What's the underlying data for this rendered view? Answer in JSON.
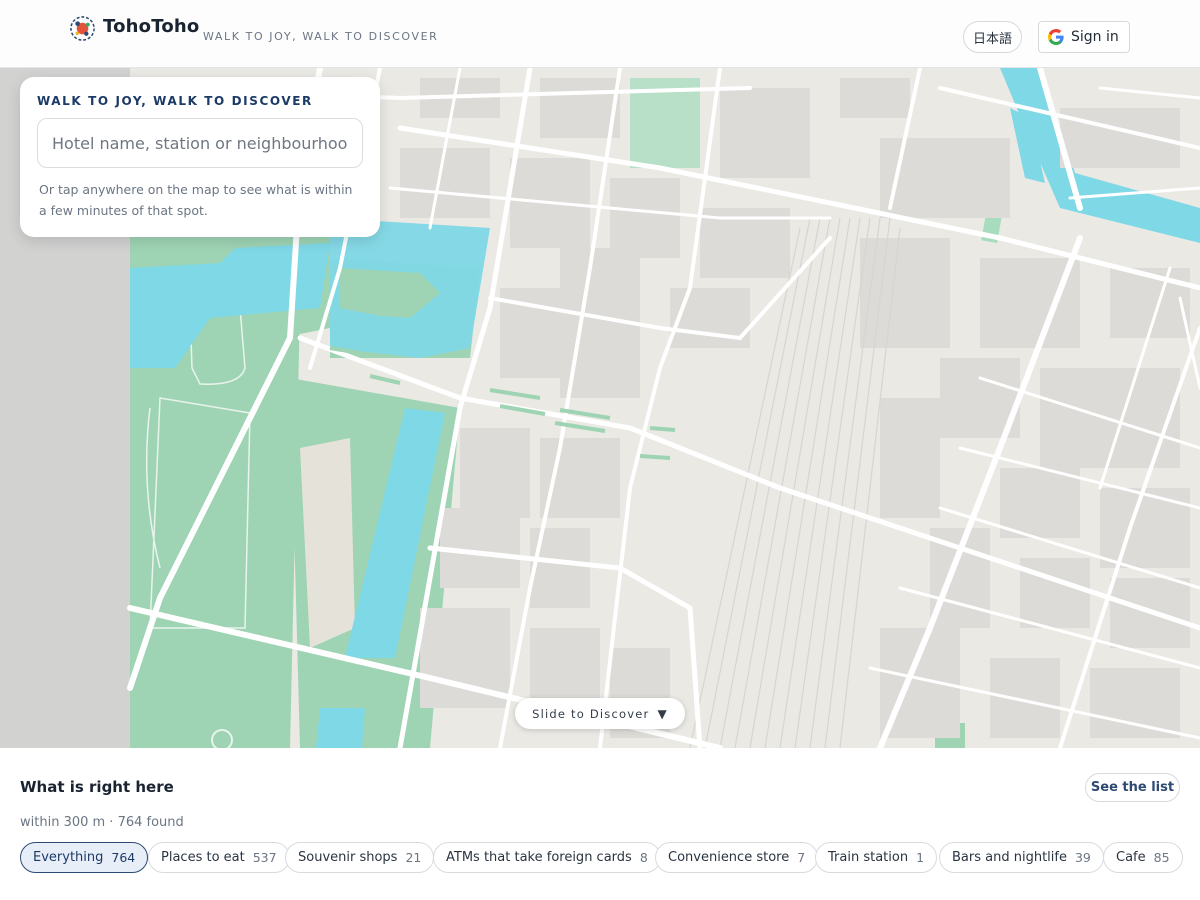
{
  "header": {
    "brand": "TohoToho",
    "tagline": "WALK TO JOY, WALK TO DISCOVER",
    "language_button": "日本語",
    "signin_label": "Sign in",
    "logo_icon": "tohotoho-logo-icon",
    "google_icon": "google-g-icon"
  },
  "search_card": {
    "heading": "WALK TO JOY, WALK TO DISCOVER",
    "placeholder": "Hotel name, station or neighbourhood",
    "value": "",
    "hint": "Or tap anywhere on the map to see what is within a few minutes of that spot."
  },
  "map": {
    "slide_label": "Slide to Discover",
    "slide_arrow": "▼",
    "colors": {
      "land": "#ebe9e4",
      "park": "#9ed4b4",
      "water": "#7fd8e6",
      "road": "#ffffff",
      "building": "#dcdbd7"
    }
  },
  "panel": {
    "title": "What is right here",
    "subtitle": "within 300 m · 764 found",
    "see_list_label": "See the list",
    "chips": [
      {
        "label": "Everything",
        "count": "764",
        "active": true
      },
      {
        "label": "Places to eat",
        "count": "537",
        "active": false
      },
      {
        "label": "Souvenir shops",
        "count": "21",
        "active": false
      },
      {
        "label": "ATMs that take foreign cards",
        "count": "8",
        "active": false
      },
      {
        "label": "Convenience store",
        "count": "7",
        "active": false
      },
      {
        "label": "Train station",
        "count": "1",
        "active": false
      },
      {
        "label": "Bars and nightlife",
        "count": "39",
        "active": false
      },
      {
        "label": "Cafe",
        "count": "85",
        "active": false
      }
    ]
  }
}
